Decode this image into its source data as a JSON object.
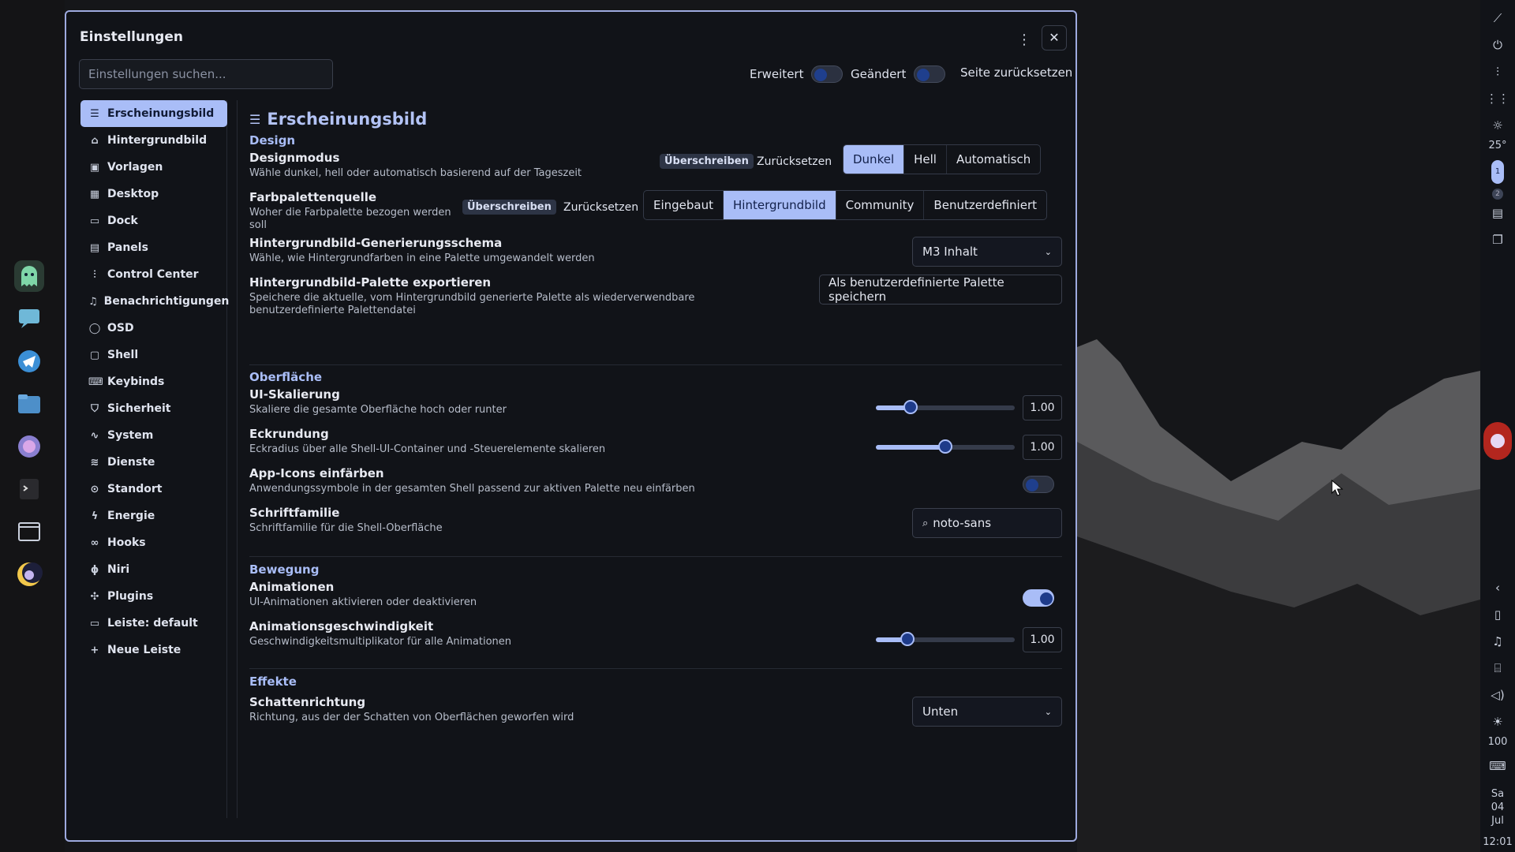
{
  "window": {
    "title": "Einstellungen",
    "search_placeholder": "Einstellungen suchen...",
    "advanced_label": "Erweitert",
    "advanced_on": false,
    "changed_label": "Geändert",
    "changed_on": false,
    "reset_page_label": "Seite zurücksetzen",
    "close_symbol": "✕",
    "menu_symbol": "⋮"
  },
  "sidebar": {
    "items": [
      {
        "label": "Erscheinungsbild",
        "icon": "sliders-icon",
        "glyph": "☰",
        "active": true
      },
      {
        "label": "Hintergrundbild",
        "icon": "paint-brush-icon",
        "glyph": "⌂"
      },
      {
        "label": "Vorlagen",
        "icon": "template-icon",
        "glyph": "▣"
      },
      {
        "label": "Desktop",
        "icon": "desktop-icon",
        "glyph": "▦"
      },
      {
        "label": "Dock",
        "icon": "dock-icon",
        "glyph": "▭"
      },
      {
        "label": "Panels",
        "icon": "panels-icon",
        "glyph": "▤"
      },
      {
        "label": "Control Center",
        "icon": "control-center-icon",
        "glyph": "⫶"
      },
      {
        "label": "Benachrichtigungen",
        "icon": "bell-icon",
        "glyph": "♫"
      },
      {
        "label": "OSD",
        "icon": "chat-bubble-icon",
        "glyph": "◯"
      },
      {
        "label": "Shell",
        "icon": "shell-icon",
        "glyph": "▢"
      },
      {
        "label": "Keybinds",
        "icon": "keyboard-icon",
        "glyph": "⌨"
      },
      {
        "label": "Sicherheit",
        "icon": "shield-icon",
        "glyph": "⛉"
      },
      {
        "label": "System",
        "icon": "activity-icon",
        "glyph": "∿"
      },
      {
        "label": "Dienste",
        "icon": "layers-icon",
        "glyph": "≋"
      },
      {
        "label": "Standort",
        "icon": "location-pin-icon",
        "glyph": "⊙"
      },
      {
        "label": "Energie",
        "icon": "bolt-icon",
        "glyph": "ϟ"
      },
      {
        "label": "Hooks",
        "icon": "link-icon",
        "glyph": "∞"
      },
      {
        "label": "Niri",
        "icon": "niri-icon",
        "glyph": "ɸ"
      },
      {
        "label": "Plugins",
        "icon": "puzzle-icon",
        "glyph": "✣"
      },
      {
        "label": "Leiste: default",
        "icon": "bar-icon",
        "glyph": "▭"
      },
      {
        "label": "Neue Leiste",
        "icon": "plus-icon",
        "glyph": "+"
      }
    ]
  },
  "page": {
    "title": "Erscheinungsbild",
    "sections": {
      "design": "Design",
      "surface": "Oberfläche",
      "motion": "Bewegung",
      "effects": "Effekte"
    },
    "override_label": "Überschreiben",
    "reset_label": "Zurücksetzen",
    "theme_mode": {
      "label": "Designmodus",
      "desc": "Wähle dunkel, hell oder automatisch basierend auf der Tageszeit",
      "options": [
        "Dunkel",
        "Hell",
        "Automatisch"
      ],
      "selected": "Dunkel"
    },
    "palette_source": {
      "label": "Farbpalettenquelle",
      "desc": "Woher die Farbpalette bezogen werden soll",
      "options": [
        "Eingebaut",
        "Hintergrundbild",
        "Community",
        "Benutzerdefiniert"
      ],
      "selected": "Hintergrundbild"
    },
    "scheme": {
      "label": "Hintergrundbild-Generierungsschema",
      "desc": "Wähle, wie Hintergrundfarben in eine Palette umgewandelt werden",
      "value": "M3 Inhalt"
    },
    "export": {
      "label": "Hintergrundbild-Palette exportieren",
      "desc": "Speichere die aktuelle, vom Hintergrundbild generierte Palette als wiederverwendbare benutzerdefinierte Palettendatei",
      "button": "Als benutzerdefinierte Palette speichern"
    },
    "ui_scale": {
      "label": "UI-Skalierung",
      "desc": "Skaliere die gesamte Oberfläche hoch oder runter",
      "value": "1.00",
      "fraction": 0.25
    },
    "corner": {
      "label": "Eckrundung",
      "desc": "Eckradius über alle Shell-UI-Container und -Steuerelemente skalieren",
      "value": "1.00",
      "fraction": 0.5
    },
    "recolor": {
      "label": "App-Icons einfärben",
      "desc": "Anwendungssymbole in der gesamten Shell passend zur aktiven Palette neu einfärben",
      "on": false
    },
    "font": {
      "label": "Schriftfamilie",
      "desc": "Schriftfamilie für die Shell-Oberfläche",
      "value": "noto-sans"
    },
    "animations": {
      "label": "Animationen",
      "desc": "UI-Animationen aktivieren oder deaktivieren",
      "on": true
    },
    "anim_speed": {
      "label": "Animationsgeschwindigkeit",
      "desc": "Geschwindigkeitsmultiplikator für alle Animationen",
      "value": "1.00",
      "fraction": 0.23
    },
    "shadow": {
      "label": "Schattenrichtung",
      "desc": "Richtung, aus der der Schatten von Oberflächen geworfen wird",
      "value": "Unten"
    }
  },
  "panel": {
    "temperature": "25°",
    "workspaces": [
      "1",
      "2"
    ],
    "brightness": "100",
    "date_day": "Sa",
    "date_num": "04",
    "date_month": "Jul",
    "time": "12:01"
  },
  "colors": {
    "accent": "#a9bdf7",
    "window_bg": "#111318",
    "border": "#9eaadf"
  }
}
